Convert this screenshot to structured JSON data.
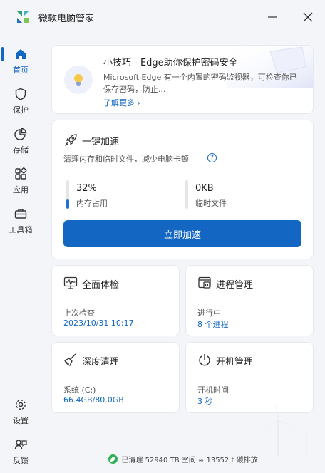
{
  "app": {
    "title": "微软电脑管家"
  },
  "sidebar": {
    "items": [
      {
        "label": "首页",
        "icon": "home-icon",
        "active": true
      },
      {
        "label": "保护",
        "icon": "shield-icon"
      },
      {
        "label": "存储",
        "icon": "pie-chart-icon"
      },
      {
        "label": "应用",
        "icon": "apps-grid-icon"
      },
      {
        "label": "工具箱",
        "icon": "toolbox-icon"
      }
    ],
    "bottom": [
      {
        "label": "设置",
        "icon": "gear-icon"
      },
      {
        "label": "反馈",
        "icon": "feedback-icon"
      }
    ]
  },
  "tip": {
    "title": "小技巧 - Edge助你保护密码安全",
    "body": "Microsoft Edge 有一个内置的密码监视器，可检查你已保存密码，防止...",
    "link": "了解更多 ›",
    "icon": "lightbulb-icon"
  },
  "speedup": {
    "title": "一键加速",
    "description": "清理内存和临时文件，减少电脑卡顿",
    "memory": {
      "value": "32%",
      "label": "内存占用",
      "fill": 0.32
    },
    "temp": {
      "value": "0KB",
      "label": "临时文件",
      "fill": 0
    },
    "button": "立即加速"
  },
  "tiles": {
    "checkup": {
      "title": "全面体检",
      "sub": "上次检查",
      "value": "2023/10/31 10:17"
    },
    "process": {
      "title": "进程管理",
      "sub": "进行中",
      "value": "8 个进程"
    },
    "clean": {
      "title": "深度清理",
      "sub": "系统 (C:)",
      "value": "66.4GB/80.0GB"
    },
    "boot": {
      "title": "开机管理",
      "sub": "开机时间",
      "value": "3 秒"
    }
  },
  "footer": {
    "text": "已清理 52940 TB 空间 ≈ 13552 t 碳排放"
  },
  "colors": {
    "accent": "#1366c2",
    "leaf": "#2eae55"
  }
}
